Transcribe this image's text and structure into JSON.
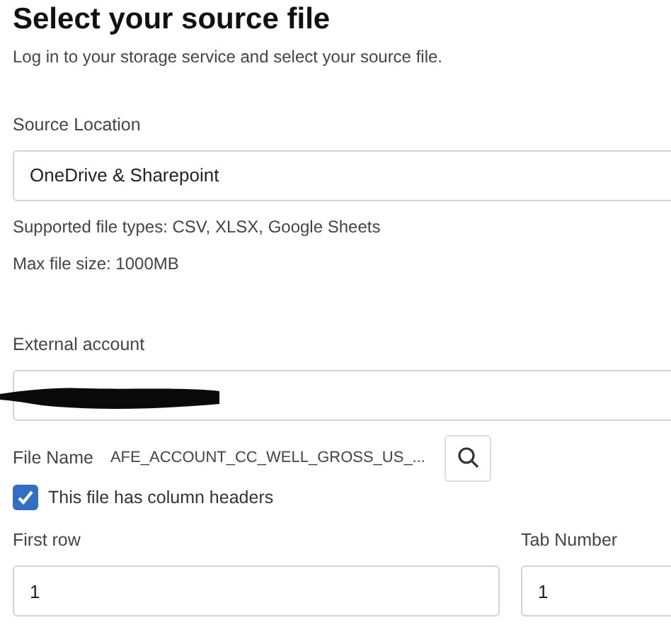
{
  "title": "Select your source file",
  "subtitle": "Log in to your storage service and select your source file.",
  "source_location": {
    "label": "Source Location",
    "value": "OneDrive & Sharepoint"
  },
  "notes": [
    "Supported file types: CSV, XLSX, Google Sheets",
    "Max file size: 1000MB"
  ],
  "external_account": {
    "label": "External account"
  },
  "file_name": {
    "label": "File Name",
    "value": "AFE_ACCOUNT_CC_WELL_GROSS_US_..."
  },
  "headers_checkbox": {
    "label": "This file has column headers",
    "checked": true
  },
  "first_row": {
    "label": "First row",
    "value": "1"
  },
  "tab_number": {
    "label": "Tab Number",
    "value": "1"
  }
}
